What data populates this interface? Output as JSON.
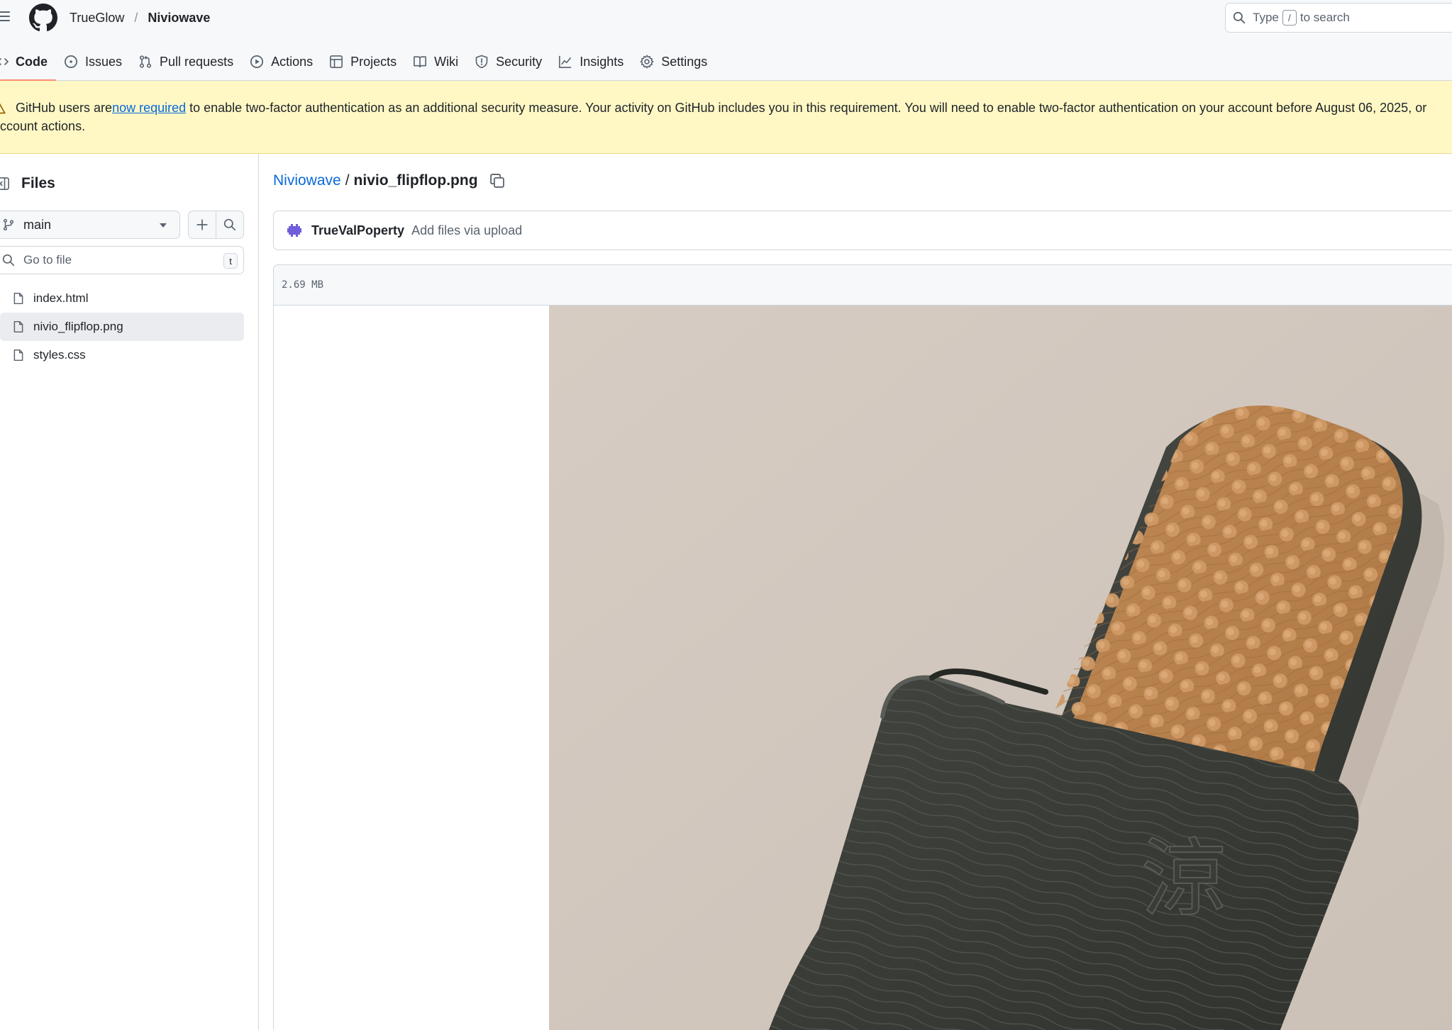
{
  "header": {
    "owner": "TrueGlow",
    "separator": "/",
    "repo": "Niviowave",
    "search": {
      "prefix": "Type",
      "key": "/",
      "suffix": "to search"
    }
  },
  "tabs": [
    {
      "label": "Code",
      "icon": "code-icon",
      "active": true
    },
    {
      "label": "Issues",
      "icon": "issue-opened-icon"
    },
    {
      "label": "Pull requests",
      "icon": "git-pull-request-icon"
    },
    {
      "label": "Actions",
      "icon": "play-icon"
    },
    {
      "label": "Projects",
      "icon": "table-icon"
    },
    {
      "label": "Wiki",
      "icon": "book-icon"
    },
    {
      "label": "Security",
      "icon": "shield-icon"
    },
    {
      "label": "Insights",
      "icon": "graph-icon"
    },
    {
      "label": "Settings",
      "icon": "gear-icon"
    }
  ],
  "banner": {
    "before_link": "GitHub users are ",
    "link": "now required",
    "after_link": " to enable two-factor authentication as an additional security measure. Your activity on GitHub includes you in this requirement. You will need to enable two-factor authentication on your account before August 06, 2025, or",
    "line2": "ccount actions."
  },
  "sidebar": {
    "title": "Files",
    "branch": "main",
    "goto_placeholder": "Go to file",
    "goto_key": "t",
    "files": [
      {
        "name": "index.html",
        "selected": false
      },
      {
        "name": "nivio_flipflop.png",
        "selected": true
      },
      {
        "name": "styles.css",
        "selected": false
      }
    ]
  },
  "breadcrumb": {
    "repo": "Niviowave",
    "separator": "/",
    "file": "nivio_flipflop.png"
  },
  "commit": {
    "author": "TrueValPoperty",
    "message": "Add files via upload"
  },
  "viewer": {
    "size": "2.69 MB",
    "image_kanji": "涼"
  },
  "colors": {
    "accent_link": "#0969da",
    "tab_underline": "#fd8c73",
    "banner_bg": "#fff8c5",
    "photo_background": "#d8cfc6",
    "strap": "#3b3d39",
    "footbed": "#b88150"
  }
}
